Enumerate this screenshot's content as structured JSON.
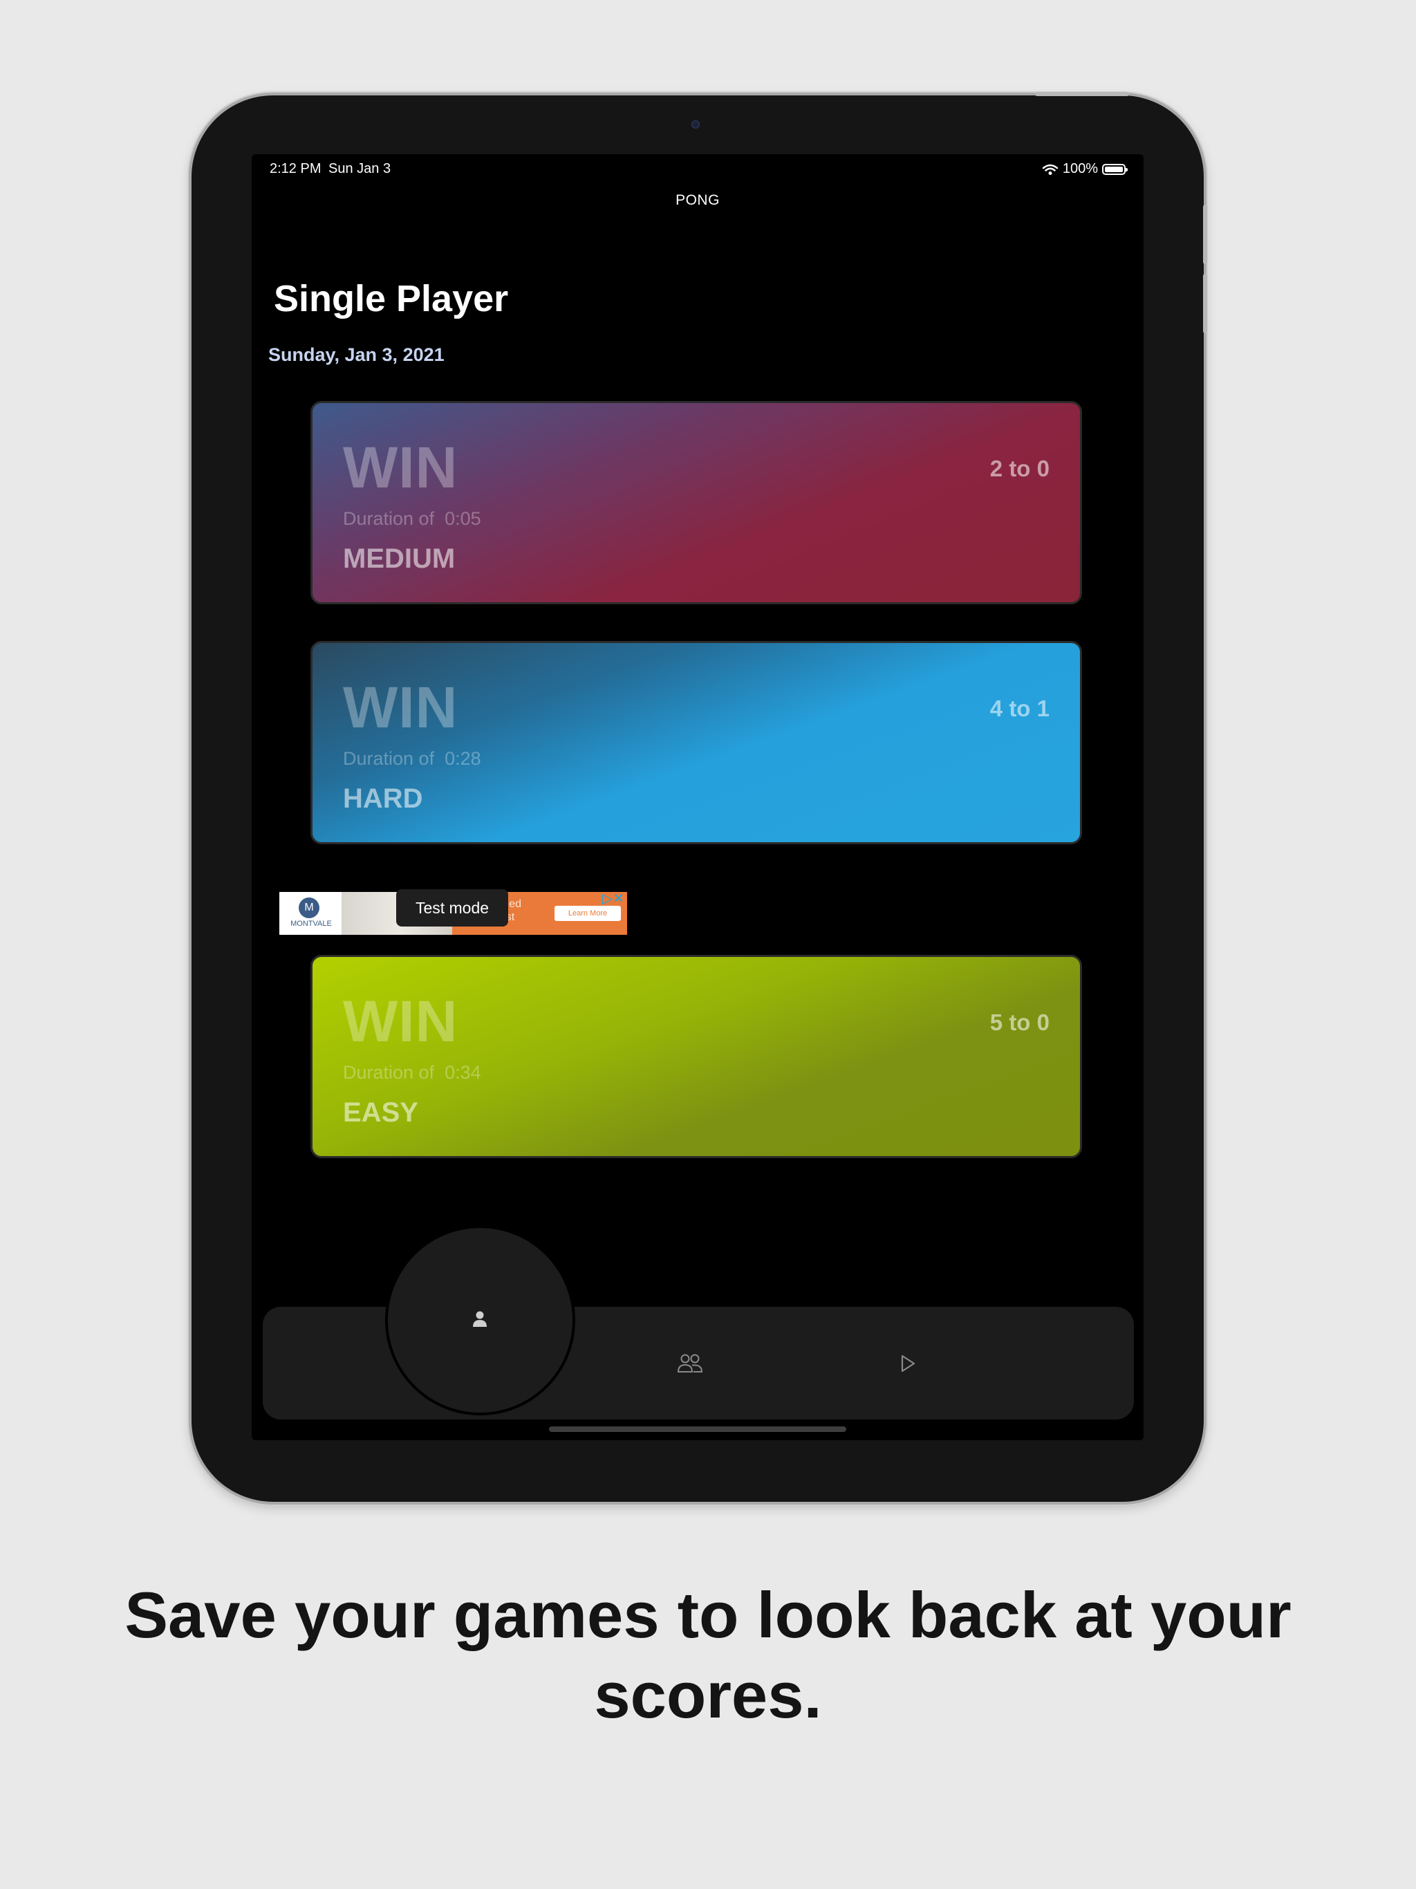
{
  "status_bar": {
    "time": "2:12 PM",
    "date": "Sun Jan 3",
    "battery": "100%"
  },
  "nav": {
    "title": "PONG"
  },
  "page": {
    "title": "Single Player",
    "section_date": "Sunday, Jan 3, 2021"
  },
  "games": [
    {
      "result": "WIN",
      "score": "2 to 0",
      "duration_label": "Duration of",
      "duration": "0:05",
      "difficulty": "MEDIUM",
      "color": "#8a2440"
    },
    {
      "result": "WIN",
      "score": "4 to 1",
      "duration_label": "Duration of",
      "duration": "0:28",
      "difficulty": "HARD",
      "color": "#25a0dc"
    },
    {
      "result": "WIN",
      "score": "5 to 0",
      "duration_label": "Duration of",
      "duration": "0:34",
      "difficulty": "EASY",
      "color": "#96b407"
    }
  ],
  "ad": {
    "badge": "Test mode",
    "logo_text": "MONTVALE",
    "text_line1": "ertified",
    "text_line2": "ontist",
    "button": "Learn More"
  },
  "tabbar": {
    "tabs": [
      {
        "icon": "person-icon",
        "selected": true
      },
      {
        "icon": "two-people-icon",
        "selected": false
      },
      {
        "icon": "play-icon",
        "selected": false
      }
    ]
  },
  "caption": {
    "line1": "Save your games to look back at your",
    "line2": "scores."
  }
}
